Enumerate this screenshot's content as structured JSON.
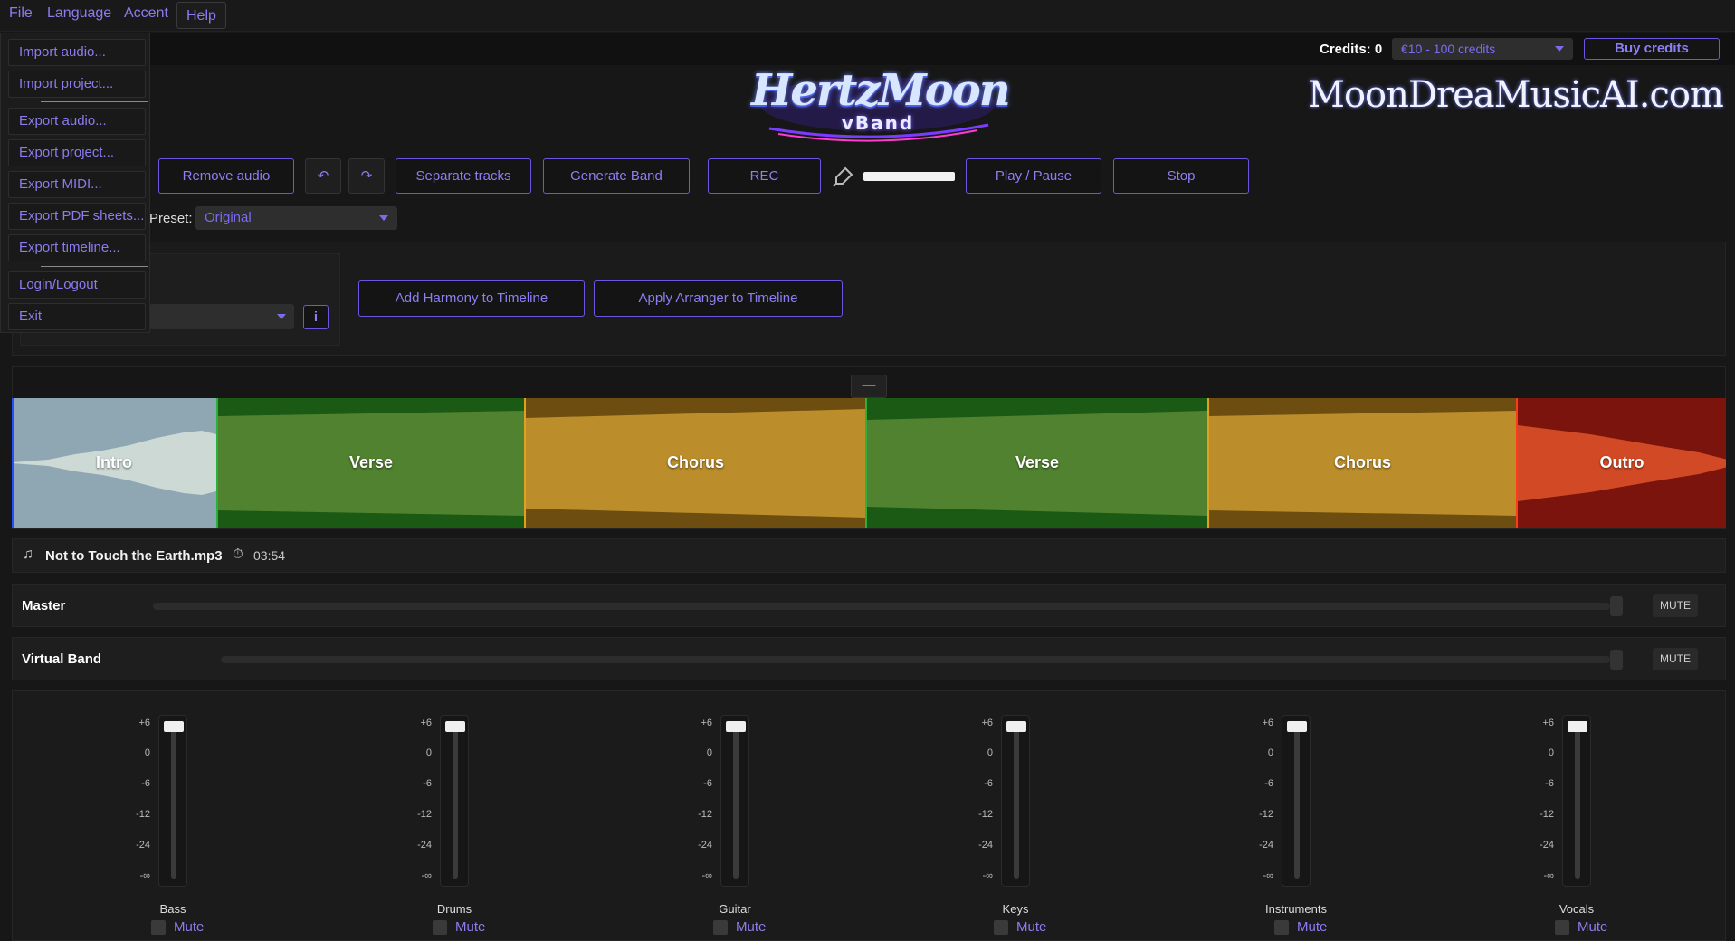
{
  "menubar": {
    "items": [
      {
        "label": "File"
      },
      {
        "label": "Language"
      },
      {
        "label": "Accent"
      },
      {
        "label": "Help"
      }
    ]
  },
  "file_menu": {
    "items": [
      {
        "label": "Import audio..."
      },
      {
        "label": "Import project..."
      },
      {
        "label": "Export audio..."
      },
      {
        "label": "Export project..."
      },
      {
        "label": "Export MIDI..."
      },
      {
        "label": "Export PDF sheets..."
      },
      {
        "label": "Export timeline..."
      },
      {
        "label": "Login/Logout"
      },
      {
        "label": "Exit"
      }
    ]
  },
  "header": {
    "credits_label": "Credits: 0",
    "credits_select_value": "€10 - 100 credits",
    "buy_label": "Buy credits"
  },
  "logos": {
    "hertzmoon": "HertzMoon",
    "hertzmoon_sub": "vBand",
    "moondream": "MoonDreaMusicAI.com"
  },
  "toolbar": {
    "remove_audio": "Remove audio",
    "undo_icon": "undo-icon",
    "redo_icon": "redo-icon",
    "separate": "Separate tracks",
    "generate": "Generate Band",
    "rec": "REC",
    "mic_icon": "microphone-icon",
    "play_pause": "Play / Pause",
    "stop": "Stop",
    "preset_label": "Preset:",
    "preset_value": "Original"
  },
  "arranger": {
    "info_label": "i",
    "add_harmony": "Add Harmony to Timeline",
    "apply_arranger": "Apply Arranger to Timeline"
  },
  "timeline": {
    "collapse_label": "—",
    "segments": [
      {
        "label": "Intro",
        "color": "#8ea7b3"
      },
      {
        "label": "Verse",
        "color": "#1b5a15"
      },
      {
        "label": "Chorus",
        "color": "#6e4e10"
      },
      {
        "label": "Verse",
        "color": "#1b5a15"
      },
      {
        "label": "Chorus",
        "color": "#6e4e10"
      },
      {
        "label": "Outro",
        "color": "#7a140c"
      }
    ]
  },
  "file_info": {
    "filename": "Not to Touch the Earth.mp3",
    "duration": "03:54",
    "file_icon": "music-note-icon",
    "timer_icon": "stopwatch-icon"
  },
  "master": {
    "label": "Master",
    "mute": "MUTE"
  },
  "virtual_band": {
    "label": "Virtual Band",
    "mute": "MUTE"
  },
  "mixer": {
    "scale": [
      "+6",
      "0",
      "-6",
      "-12",
      "-24",
      "-∞"
    ],
    "channels": [
      {
        "name": "Bass",
        "mute": "Mute"
      },
      {
        "name": "Drums",
        "mute": "Mute"
      },
      {
        "name": "Guitar",
        "mute": "Mute"
      },
      {
        "name": "Keys",
        "mute": "Mute"
      },
      {
        "name": "Instruments",
        "mute": "Mute"
      },
      {
        "name": "Vocals",
        "mute": "Mute"
      }
    ]
  },
  "colors": {
    "accent": "#8b7cf0",
    "intro": "#8ea7b3",
    "verse": "#1b5a15",
    "chorus": "#6e4e10",
    "outro": "#7a140c"
  }
}
